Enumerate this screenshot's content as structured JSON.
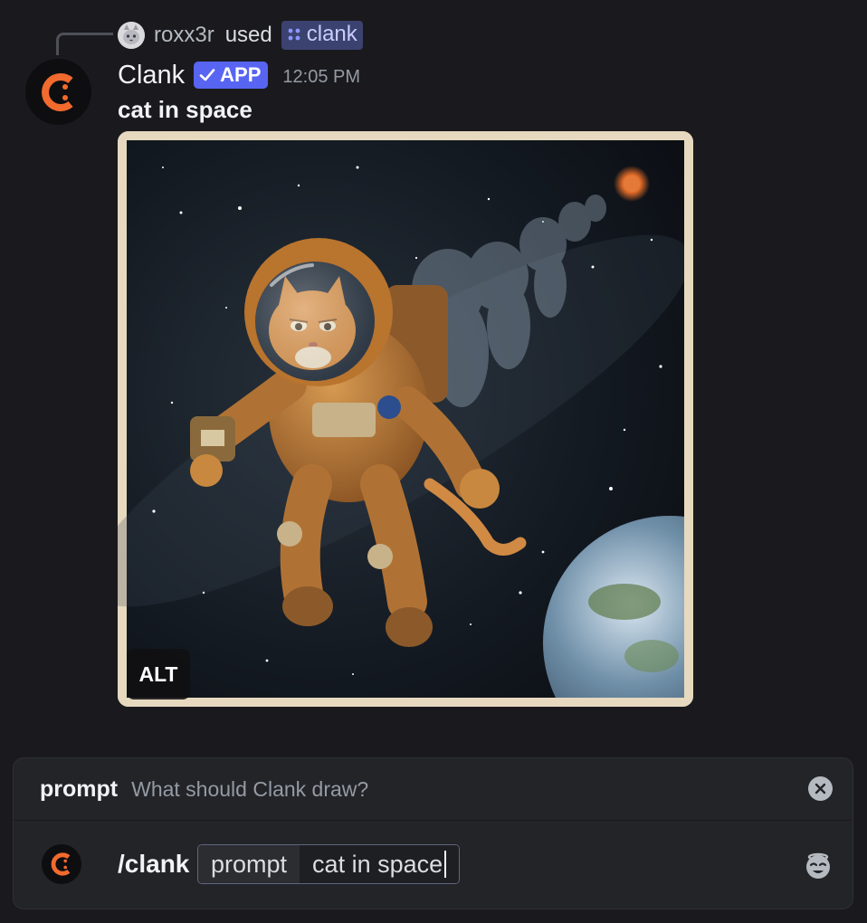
{
  "reply": {
    "username": "roxx3r",
    "used_text": "used",
    "command_name": "clank"
  },
  "message": {
    "author": "Clank",
    "badge": "APP",
    "timestamp": "12:05 PM",
    "text": "cat in space",
    "attachment": {
      "alt_label": "ALT"
    }
  },
  "composer": {
    "hint": {
      "option_name": "prompt",
      "option_description": "What should Clank draw?"
    },
    "command": "/clank",
    "option_chip": {
      "name": "prompt",
      "value": "cat in space"
    }
  },
  "colors": {
    "background": "#1a1a1e",
    "brand_orange": "#f26a2e",
    "app_badge": "#5865f2",
    "command_chip": "#3c4270"
  },
  "icons": {
    "reply_avatar": "cat-avatar-icon",
    "command_chip": "app-command-icon",
    "badge": "checkmark-icon",
    "hint_close": "close-circle-icon",
    "emoji": "emoji-picker-icon"
  }
}
